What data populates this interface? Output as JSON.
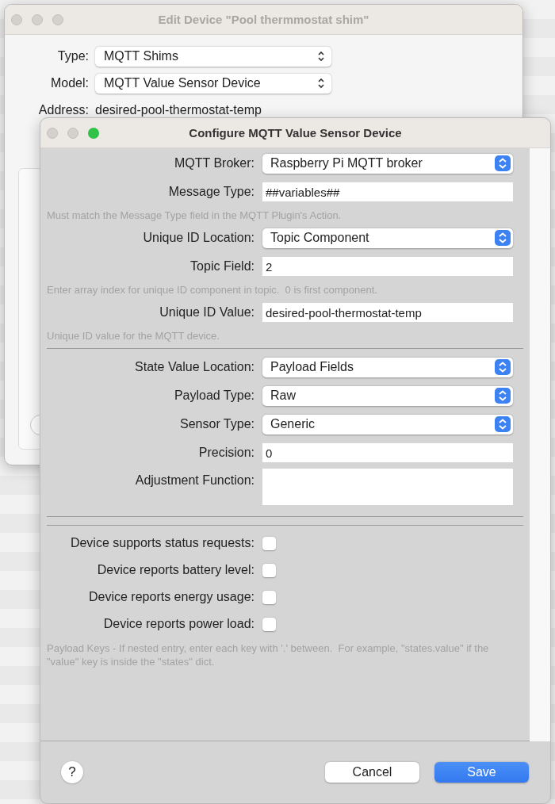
{
  "background_window": {
    "title": "Edit Device \"Pool thermmostat shim\"",
    "fields": [
      {
        "label": "Type:",
        "kind": "popup",
        "value": "MQTT Shims"
      },
      {
        "label": "Model:",
        "kind": "popup",
        "value": "MQTT Value Sensor Device"
      },
      {
        "label": "Address:",
        "kind": "text",
        "value": "desired-pool-thermostat-temp"
      }
    ],
    "panel": true
  },
  "dialog": {
    "title": "Configure MQTT Value Sensor Device",
    "rows": [
      {
        "kind": "popup",
        "label": "MQTT Broker:",
        "value": "Raspberry Pi MQTT broker"
      },
      {
        "kind": "field",
        "label": "Message Type:",
        "value": "##variables##"
      },
      {
        "kind": "hint",
        "text": "Must match the Message Type field in the MQTT Plugin's Action."
      },
      {
        "kind": "popup",
        "label": "Unique ID Location:",
        "value": "Topic Component"
      },
      {
        "kind": "field",
        "label": "Topic Field:",
        "value": "2"
      },
      {
        "kind": "hint",
        "text": "Enter array index for unique ID component in topic.  0 is first component."
      },
      {
        "kind": "field",
        "label": "Unique ID Value:",
        "value": "desired-pool-thermostat-temp"
      },
      {
        "kind": "hint",
        "text": "Unique ID value for the MQTT device."
      },
      {
        "kind": "rule"
      },
      {
        "kind": "popup",
        "label": "State Value Location:",
        "value": "Payload Fields"
      },
      {
        "kind": "popup",
        "label": "Payload Type:",
        "value": "Raw"
      },
      {
        "kind": "popup",
        "label": "Sensor Type:",
        "value": "Generic"
      },
      {
        "kind": "field",
        "label": "Precision:",
        "value": "0"
      },
      {
        "kind": "textarea",
        "label": "Adjustment Function:"
      },
      {
        "kind": "double_rule"
      },
      {
        "kind": "checkbox",
        "label": "Device supports status requests:",
        "checked": false
      },
      {
        "kind": "checkbox",
        "label": "Device reports battery level:",
        "checked": false
      },
      {
        "kind": "checkbox",
        "label": "Device reports energy usage:",
        "checked": false
      },
      {
        "kind": "checkbox",
        "label": "Device reports power load:",
        "checked": false
      },
      {
        "kind": "note",
        "text": "Payload Keys - If nested entry, enter each key with '.' between.  For example, \"states.value\" if the \"value\" key is inside the \"states\" dict."
      }
    ],
    "help_button": "?",
    "buttons": [
      {
        "label": "Cancel",
        "default": false
      },
      {
        "label": "Save",
        "default": true
      }
    ]
  }
}
